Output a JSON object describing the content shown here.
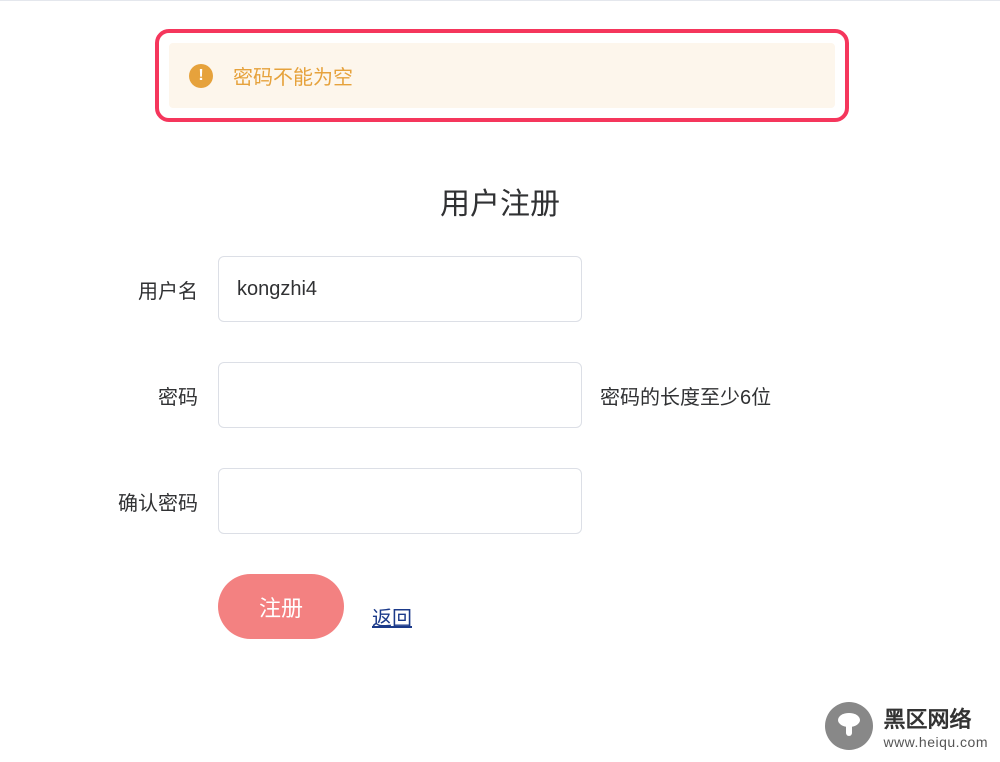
{
  "alert": {
    "message": "密码不能为空"
  },
  "form": {
    "title": "用户注册",
    "fields": {
      "username": {
        "label": "用户名",
        "value": "kongzhi4"
      },
      "password": {
        "label": "密码",
        "value": "",
        "hint": "密码的长度至少6位"
      },
      "confirm_password": {
        "label": "确认密码",
        "value": ""
      }
    },
    "buttons": {
      "register": "注册",
      "back": "返回"
    }
  },
  "watermark": {
    "name": "黑区网络",
    "url": "www.heiqu.com"
  }
}
